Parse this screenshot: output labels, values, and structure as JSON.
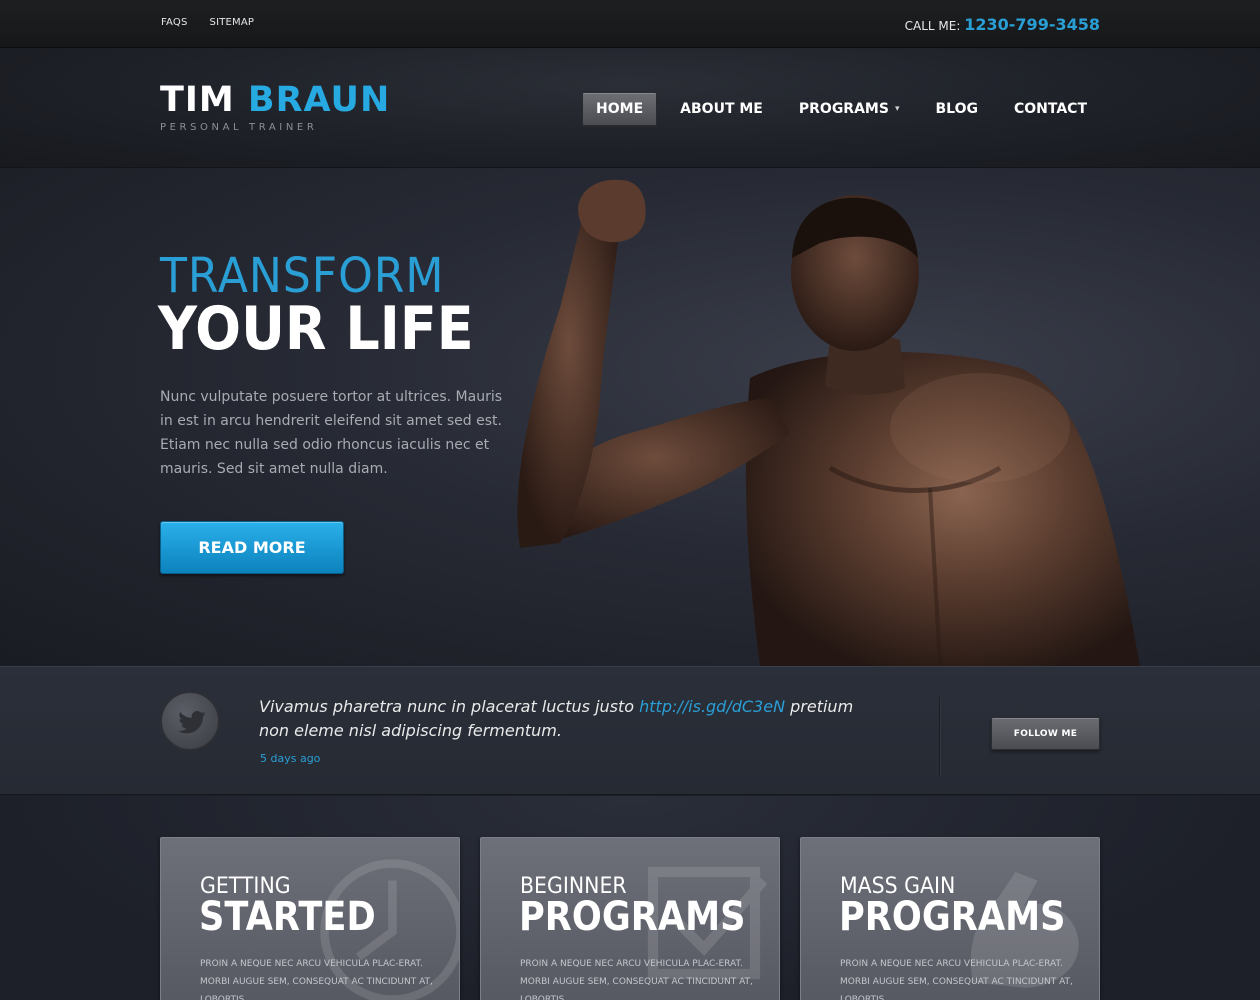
{
  "topbar": {
    "links": [
      "FAQS",
      "SITEMAP"
    ],
    "call_label": "CALL ME:",
    "phone": "1230-799-3458"
  },
  "header": {
    "logo_first": "TIM",
    "logo_last": "BRAUN",
    "tagline": "PERSONAL TRAINER",
    "nav": [
      {
        "label": "HOME",
        "active": true
      },
      {
        "label": "ABOUT ME"
      },
      {
        "label": "PROGRAMS",
        "icon": "chevron-down-icon"
      },
      {
        "label": "BLOG"
      },
      {
        "label": "CONTACT"
      }
    ]
  },
  "hero": {
    "title_line1": "TRANSFORM",
    "title_line2": "YOUR LIFE",
    "text": "Nunc vulputate posuere tortor at ultrices. Mauris in est in arcu hendrerit eleifend sit amet sed est. Etiam nec nulla sed odio rhoncus iaculis nec et mauris. Sed sit amet nulla diam.",
    "button": "READ MORE"
  },
  "tweet": {
    "icon": "twitter-bird-icon",
    "text_before": "Vivamus pharetra nunc in placerat luctus justo ",
    "link": "http://is.gd/dC3eN",
    "text_after": " pretium non eleme nisl adipiscing fermentum.",
    "time": "5 days ago",
    "follow_button": "FOLLOW ME"
  },
  "cards": [
    {
      "line1": "GETTING",
      "line2": "STARTED",
      "text": "PROIN A NEQUE NEC ARCU VEHICULA PLAC-ERAT. MORBI AUGUE SEM, CONSEQUAT AC TINCIDUNT AT, LOBORTIS",
      "icon": "clock-icon"
    },
    {
      "line1": "BEGINNER",
      "line2": "PROGRAMS",
      "text": "PROIN A NEQUE NEC ARCU VEHICULA PLAC-ERAT. MORBI AUGUE SEM, CONSEQUAT AC TINCIDUNT AT, LOBORTIS",
      "icon": "checkbox-icon"
    },
    {
      "line1": "MASS GAIN",
      "line2": "PROGRAMS",
      "text": "PROIN A NEQUE NEC ARCU VEHICULA PLAC-ERAT. MORBI AUGUE SEM, CONSEQUAT AC TINCIDUNT AT, LOBORTIS",
      "icon": "flexing-arm-icon"
    }
  ],
  "colors": {
    "accent": "#27a9e1",
    "topbar_bg": "#1b1c1e",
    "hero_bg": "#272a34"
  }
}
